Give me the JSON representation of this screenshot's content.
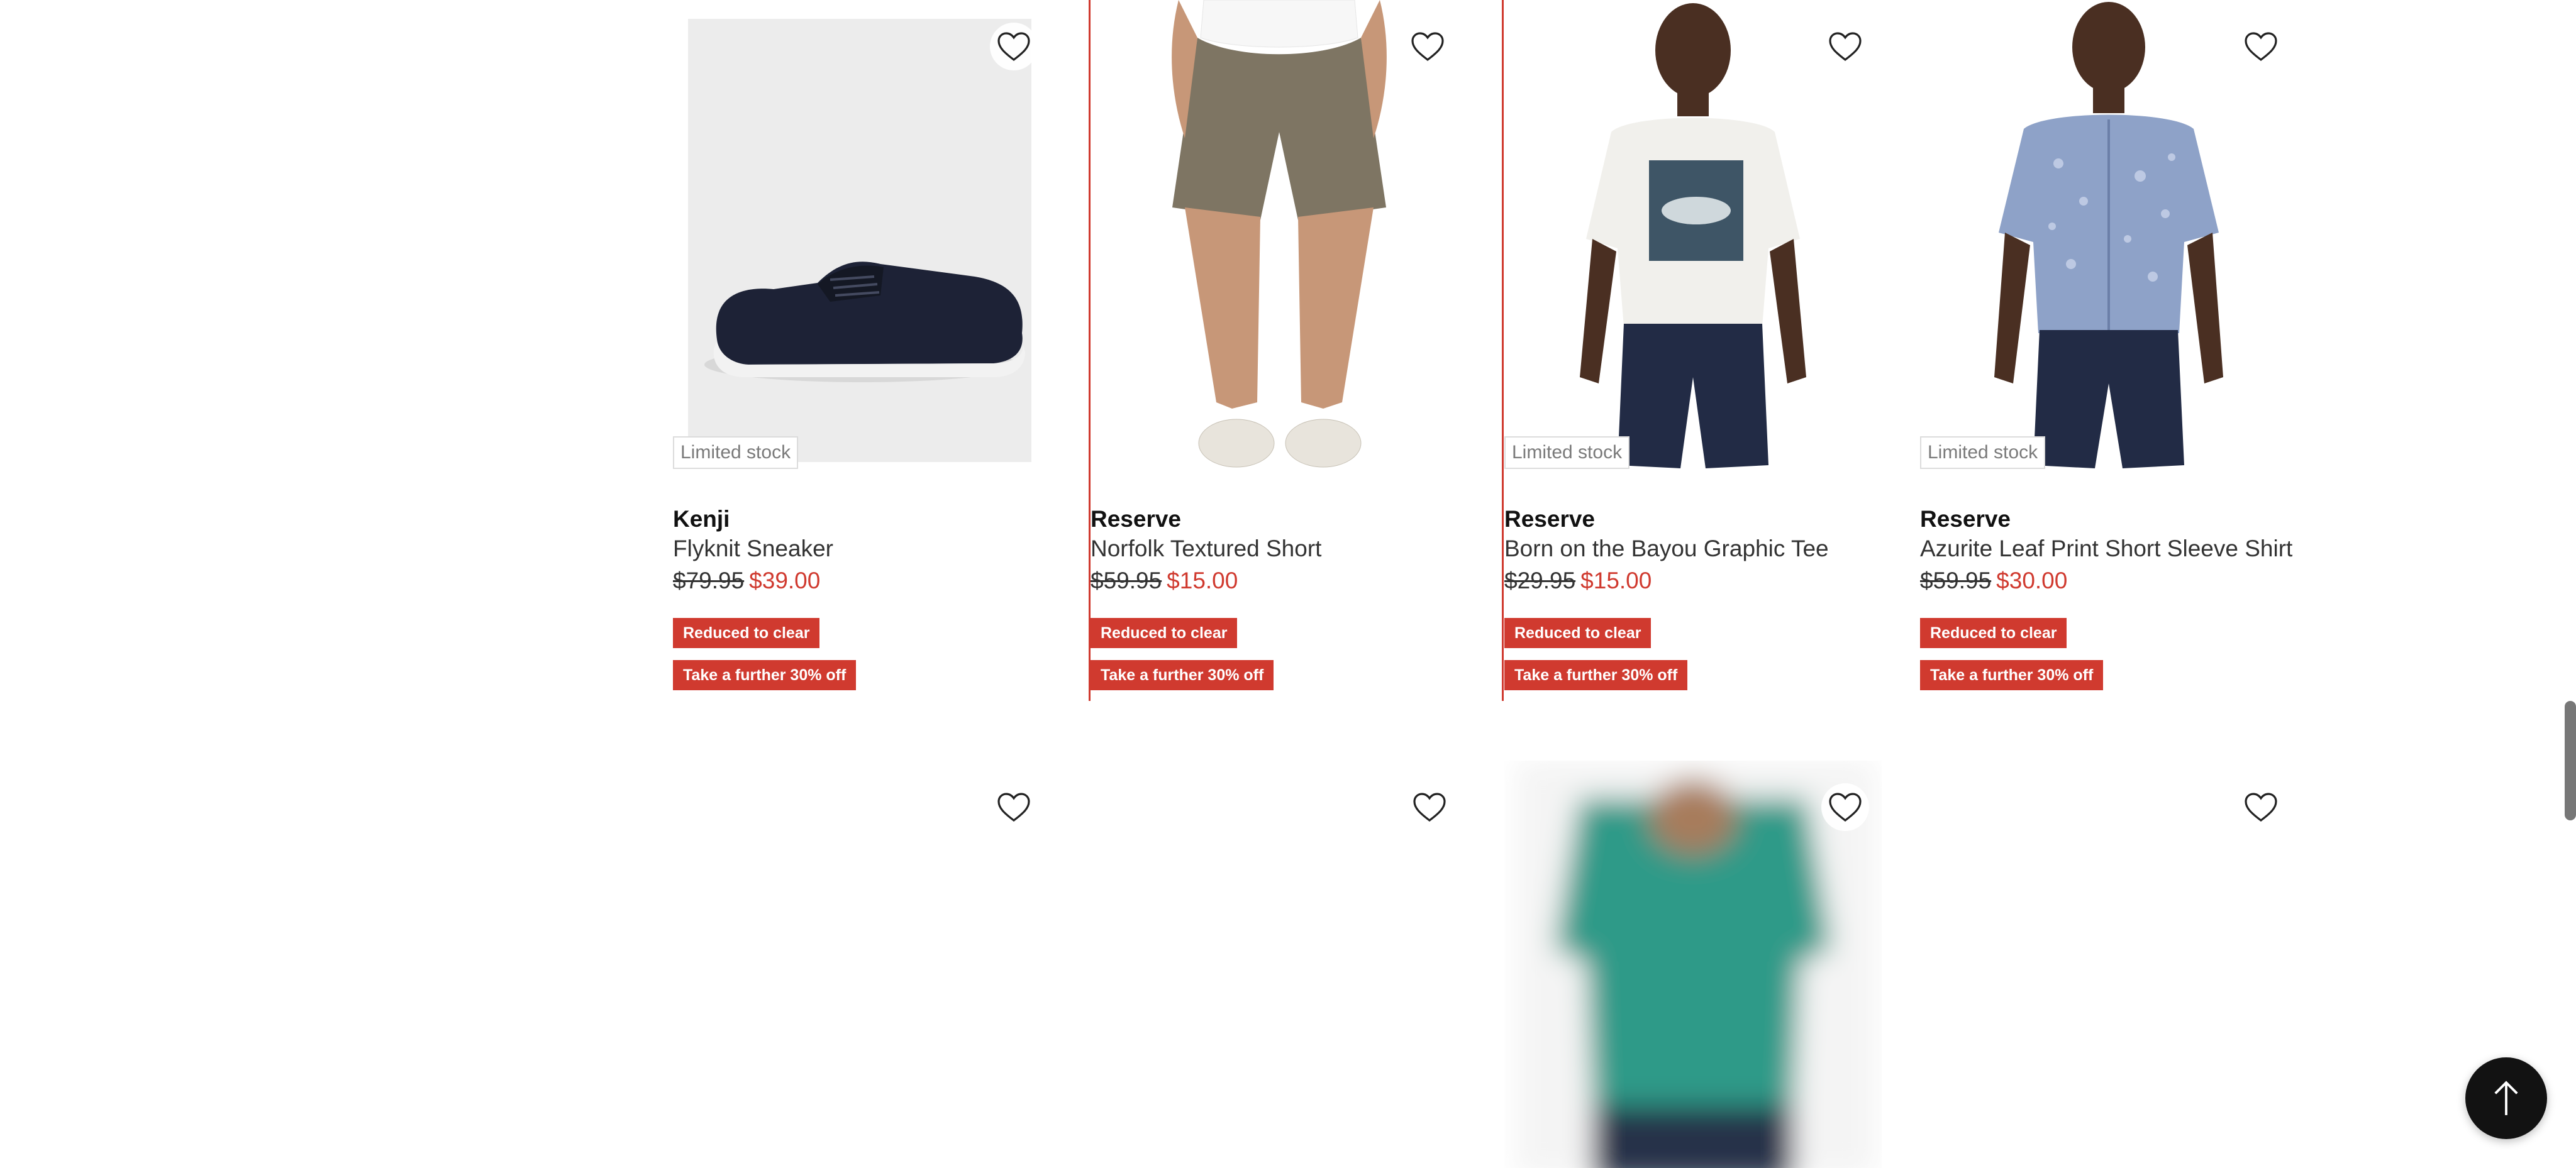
{
  "products": [
    {
      "brand": "Kenji",
      "name": "Flyknit Sneaker",
      "was_price": "$79.95",
      "price": "$39.00",
      "stock": "Limited stock",
      "tag1": "Reduced to clear",
      "tag2": "Take a further 30% off"
    },
    {
      "brand": "Reserve",
      "name": "Norfolk Textured Short",
      "was_price": "$59.95",
      "price": "$15.00",
      "stock": "",
      "tag1": "Reduced to clear",
      "tag2": "Take a further 30% off"
    },
    {
      "brand": "Reserve",
      "name": "Born on the Bayou Graphic Tee",
      "was_price": "$29.95",
      "price": "$15.00",
      "stock": "Limited stock",
      "tag1": "Reduced to clear",
      "tag2": "Take a further 30% off"
    },
    {
      "brand": "Reserve",
      "name": "Azurite Leaf Print Short Sleeve Shirt",
      "was_price": "$59.95",
      "price": "$30.00",
      "stock": "Limited stock",
      "tag1": "Reduced to clear",
      "tag2": "Take a further 30% off"
    }
  ],
  "icons": {
    "wishlist": "heart-outline-icon",
    "back_to_top": "arrow-up-icon"
  },
  "colors": {
    "sale_red": "#d03a2f",
    "button_dark": "#121212"
  }
}
